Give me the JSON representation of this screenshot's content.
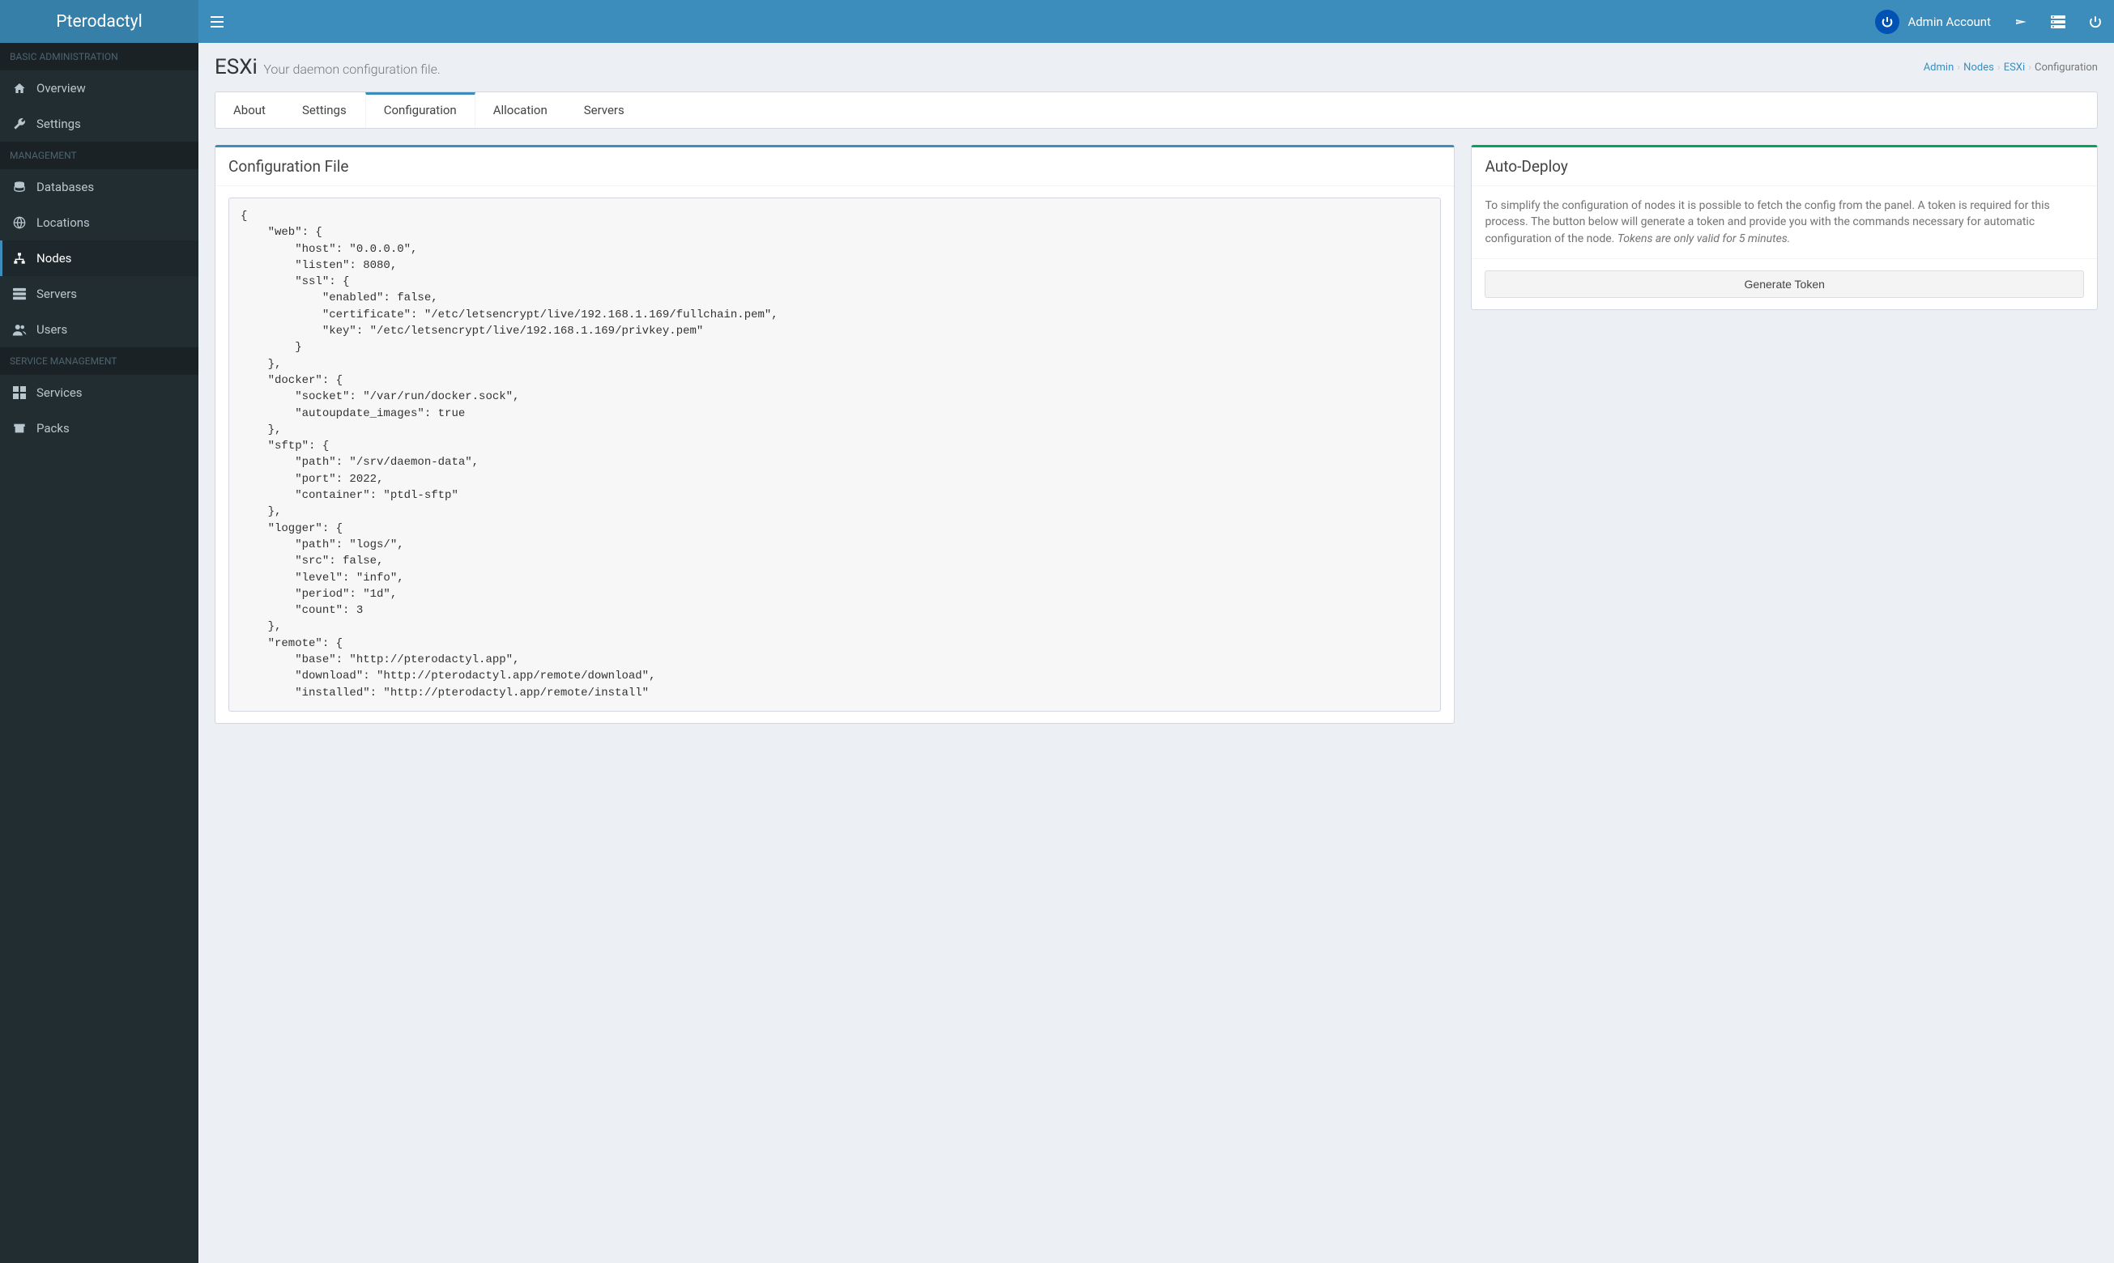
{
  "brand": "Pterodactyl",
  "topbar": {
    "account_label": "Admin Account"
  },
  "sidebar": {
    "sections": [
      {
        "header": "BASIC ADMINISTRATION",
        "items": [
          {
            "label": "Overview",
            "icon": "home",
            "name": "sidebar-item-overview"
          },
          {
            "label": "Settings",
            "icon": "wrench",
            "name": "sidebar-item-settings"
          }
        ]
      },
      {
        "header": "MANAGEMENT",
        "items": [
          {
            "label": "Databases",
            "icon": "database",
            "name": "sidebar-item-databases"
          },
          {
            "label": "Locations",
            "icon": "globe",
            "name": "sidebar-item-locations"
          },
          {
            "label": "Nodes",
            "icon": "sitemap",
            "name": "sidebar-item-nodes",
            "active": true
          },
          {
            "label": "Servers",
            "icon": "server",
            "name": "sidebar-item-servers"
          },
          {
            "label": "Users",
            "icon": "users",
            "name": "sidebar-item-users"
          }
        ]
      },
      {
        "header": "SERVICE MANAGEMENT",
        "items": [
          {
            "label": "Services",
            "icon": "th-large",
            "name": "sidebar-item-services"
          },
          {
            "label": "Packs",
            "icon": "archive",
            "name": "sidebar-item-packs"
          }
        ]
      }
    ]
  },
  "page": {
    "title": "ESXi",
    "subtitle": "Your daemon configuration file."
  },
  "breadcrumb": {
    "items": [
      "Admin",
      "Nodes",
      "ESXi"
    ],
    "current": "Configuration"
  },
  "tabs": [
    {
      "label": "About",
      "name": "tab-about"
    },
    {
      "label": "Settings",
      "name": "tab-settings"
    },
    {
      "label": "Configuration",
      "name": "tab-configuration",
      "active": true
    },
    {
      "label": "Allocation",
      "name": "tab-allocation"
    },
    {
      "label": "Servers",
      "name": "tab-servers"
    }
  ],
  "config_card": {
    "title": "Configuration File",
    "code": "{\n    \"web\": {\n        \"host\": \"0.0.0.0\",\n        \"listen\": 8080,\n        \"ssl\": {\n            \"enabled\": false,\n            \"certificate\": \"/etc/letsencrypt/live/192.168.1.169/fullchain.pem\",\n            \"key\": \"/etc/letsencrypt/live/192.168.1.169/privkey.pem\"\n        }\n    },\n    \"docker\": {\n        \"socket\": \"/var/run/docker.sock\",\n        \"autoupdate_images\": true\n    },\n    \"sftp\": {\n        \"path\": \"/srv/daemon-data\",\n        \"port\": 2022,\n        \"container\": \"ptdl-sftp\"\n    },\n    \"logger\": {\n        \"path\": \"logs/\",\n        \"src\": false,\n        \"level\": \"info\",\n        \"period\": \"1d\",\n        \"count\": 3\n    },\n    \"remote\": {\n        \"base\": \"http://pterodactyl.app\",\n        \"download\": \"http://pterodactyl.app/remote/download\",\n        \"installed\": \"http://pterodactyl.app/remote/install\""
  },
  "deploy_card": {
    "title": "Auto-Deploy",
    "help_text": "To simplify the configuration of nodes it is possible to fetch the config from the panel. A token is required for this process. The button below will generate a token and provide you with the commands necessary for automatic configuration of the node. ",
    "help_emphasis": "Tokens are only valid for 5 minutes.",
    "button_label": "Generate Token"
  }
}
